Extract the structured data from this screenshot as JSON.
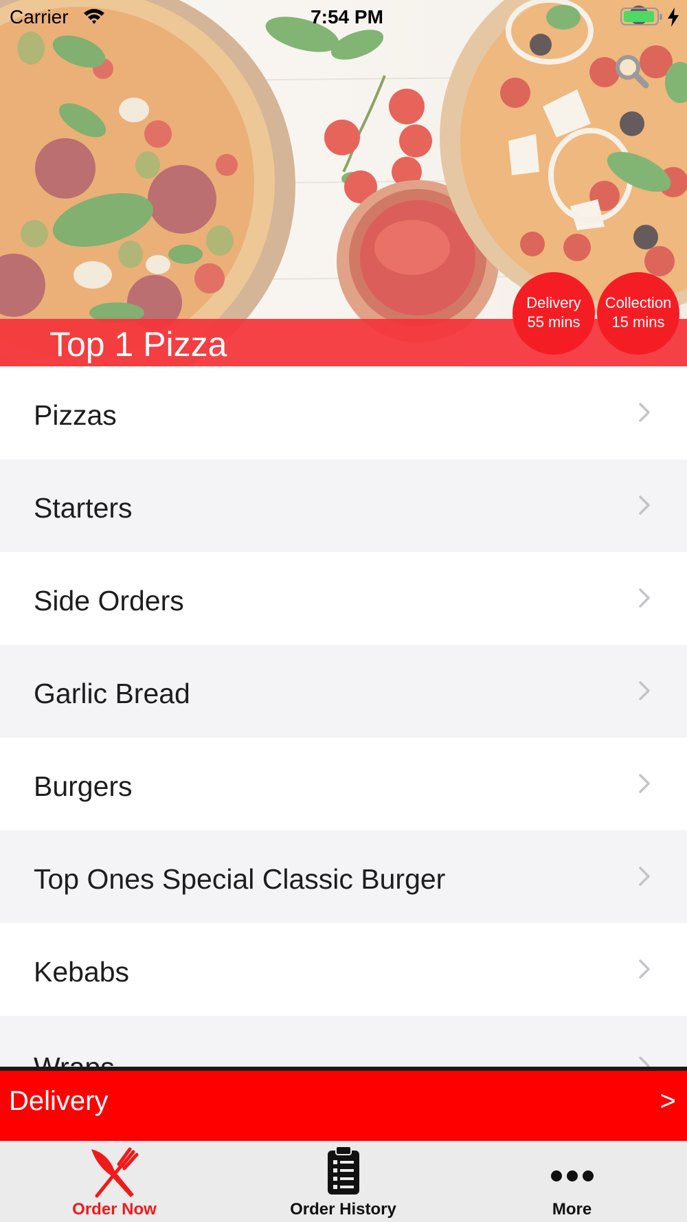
{
  "status_bar": {
    "carrier": "Carrier",
    "time": "7:54 PM"
  },
  "header": {
    "restaurant_name": "Top 1 Pizza",
    "delivery_badge": {
      "label": "Delivery",
      "time": "55 mins"
    },
    "collection_badge": {
      "label": "Collection",
      "time": "15 mins"
    }
  },
  "menu": {
    "categories": [
      {
        "label": "Pizzas"
      },
      {
        "label": "Starters"
      },
      {
        "label": "Side Orders"
      },
      {
        "label": "Garlic Bread"
      },
      {
        "label": "Burgers"
      },
      {
        "label": "Top Ones Special Classic Burger"
      },
      {
        "label": "Kebabs"
      },
      {
        "label": "Wraps"
      }
    ]
  },
  "delivery_bar": {
    "label": "Delivery",
    "arrow": ">"
  },
  "tabbar": {
    "tabs": [
      {
        "label": "Order Now",
        "icon": "fork-knife-icon",
        "active": true
      },
      {
        "label": "Order History",
        "icon": "clipboard-icon",
        "active": false
      },
      {
        "label": "More",
        "icon": "more-dots-icon",
        "active": false
      }
    ]
  },
  "colors": {
    "brand_red": "#fe0000",
    "badge_red": "#f51d24",
    "active_tab": "#f01a1a",
    "row_alt": "#f4f4f6"
  }
}
